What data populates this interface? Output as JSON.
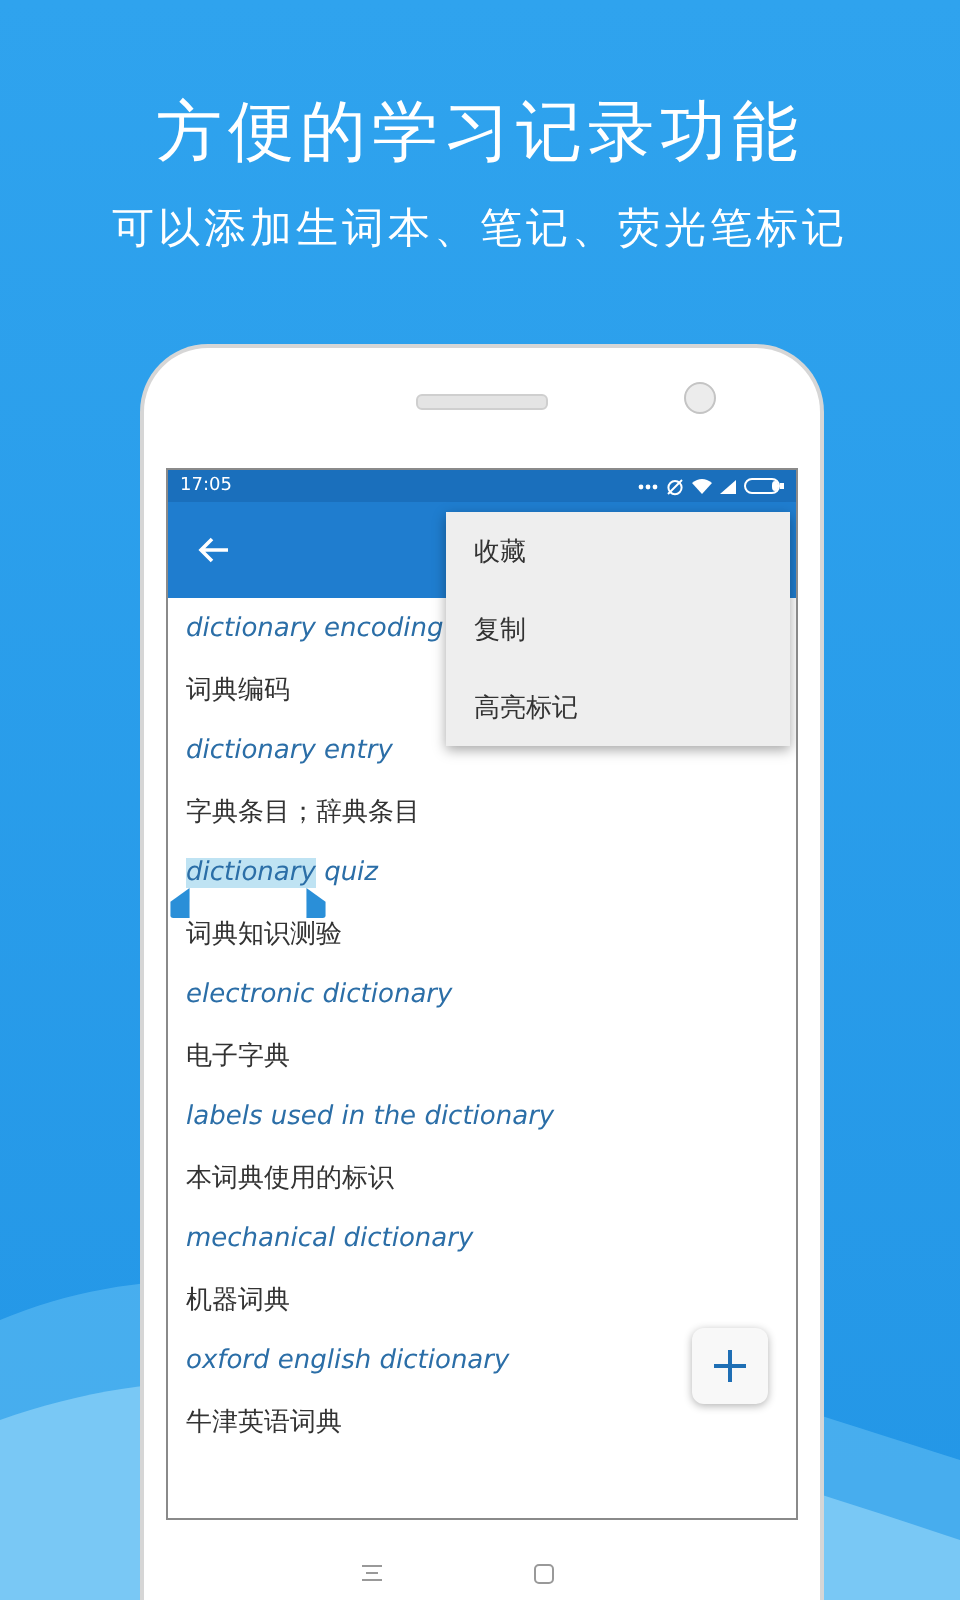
{
  "headline": "方便的学习记录功能",
  "subheadline": "可以添加生词本、笔记、荧光笔标记",
  "status_bar": {
    "time": "17:05"
  },
  "menu": {
    "items": [
      {
        "label": "收藏"
      },
      {
        "label": "复制"
      },
      {
        "label": "高亮标记"
      }
    ]
  },
  "entries": [
    {
      "term_parts": [
        {
          "text": "dictionary encoding",
          "highlighted": false
        }
      ],
      "translation": "词典编码"
    },
    {
      "term_parts": [
        {
          "text": "dictionary entry",
          "highlighted": false
        }
      ],
      "translation": "字典条目；辞典条目"
    },
    {
      "term_parts": [
        {
          "text": "dictionary",
          "highlighted": true
        },
        {
          "text": "quiz",
          "highlighted": false
        }
      ],
      "translation": "词典知识测验"
    },
    {
      "term_parts": [
        {
          "text": "electronic dictionary",
          "highlighted": false
        }
      ],
      "translation": "电子字典"
    },
    {
      "term_parts": [
        {
          "text": "labels used in the dictionary",
          "highlighted": false
        }
      ],
      "translation": "本词典使用的标识"
    },
    {
      "term_parts": [
        {
          "text": "mechanical dictionary",
          "highlighted": false
        }
      ],
      "translation": "机器词典"
    },
    {
      "term_parts": [
        {
          "text": "oxford english dictionary",
          "highlighted": false
        }
      ],
      "translation": "牛津英语词典"
    }
  ]
}
